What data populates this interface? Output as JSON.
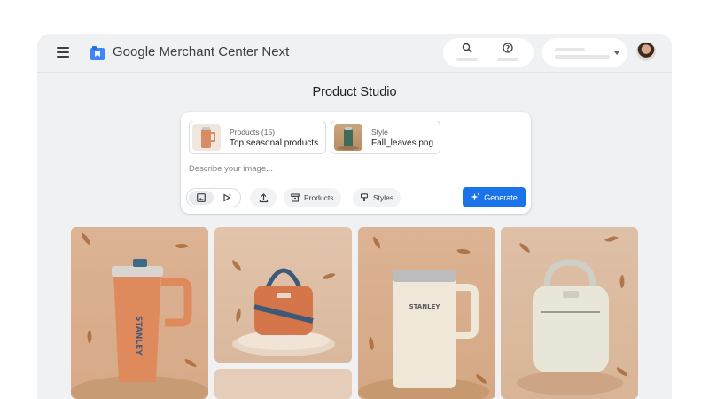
{
  "header": {
    "app_title_brand": "Google",
    "app_title_rest": "Merchant Center Next",
    "icons": [
      "menu-icon",
      "merchant-logo-icon",
      "search-icon",
      "help-icon",
      "caret-down-icon",
      "avatar"
    ]
  },
  "page": {
    "title": "Product Studio"
  },
  "prompt": {
    "products_chip": {
      "label": "Products (15)",
      "value": "Top seasonal products"
    },
    "style_chip": {
      "label": "Style",
      "value": "Fall_leaves.png"
    },
    "placeholder": "Describe your image...",
    "buttons": {
      "products": "Products",
      "styles": "Styles",
      "generate": "Generate"
    }
  },
  "colors": {
    "accent": "#1a73e8",
    "background": "#f0f1f3",
    "tile_background": "#e0bfa5"
  },
  "gallery": {
    "tiles": [
      {
        "product": "tumbler",
        "brand_text": "STANLEY"
      },
      {
        "product": "cooler-bag"
      },
      {
        "product": "mug",
        "brand_text": "STANLEY"
      },
      {
        "product": "lunch-bag"
      }
    ]
  }
}
